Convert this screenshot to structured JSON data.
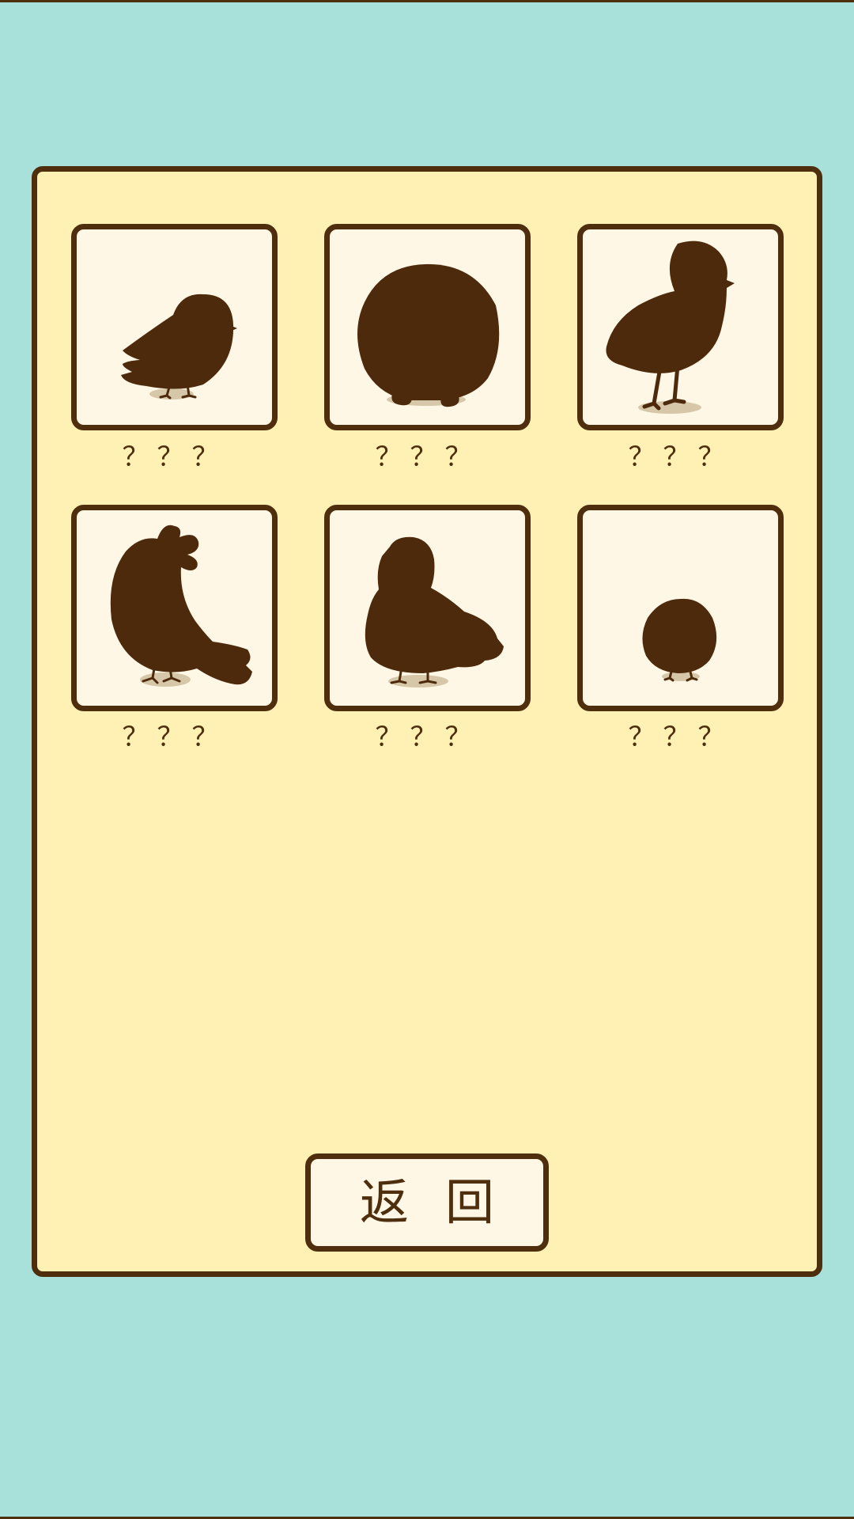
{
  "colors": {
    "background": "#a8e0da",
    "panel": "#fff0b4",
    "card": "#fff7e6",
    "outline": "#4e2e0d",
    "silhouette": "#4e2a0c",
    "shadow": "#d6c7a8"
  },
  "collection": {
    "birds": [
      {
        "icon": "sparrow-silhouette-icon",
        "name": "？？？"
      },
      {
        "icon": "round-bird-silhouette-icon",
        "name": "？？？"
      },
      {
        "icon": "chick-silhouette-icon",
        "name": "？？？"
      },
      {
        "icon": "crested-bird-silhouette-icon",
        "name": "？？？"
      },
      {
        "icon": "pigeon-silhouette-icon",
        "name": "？？？"
      },
      {
        "icon": "small-round-bird-silhouette-icon",
        "name": "？？？"
      }
    ]
  },
  "back_button": {
    "label": "返回"
  }
}
